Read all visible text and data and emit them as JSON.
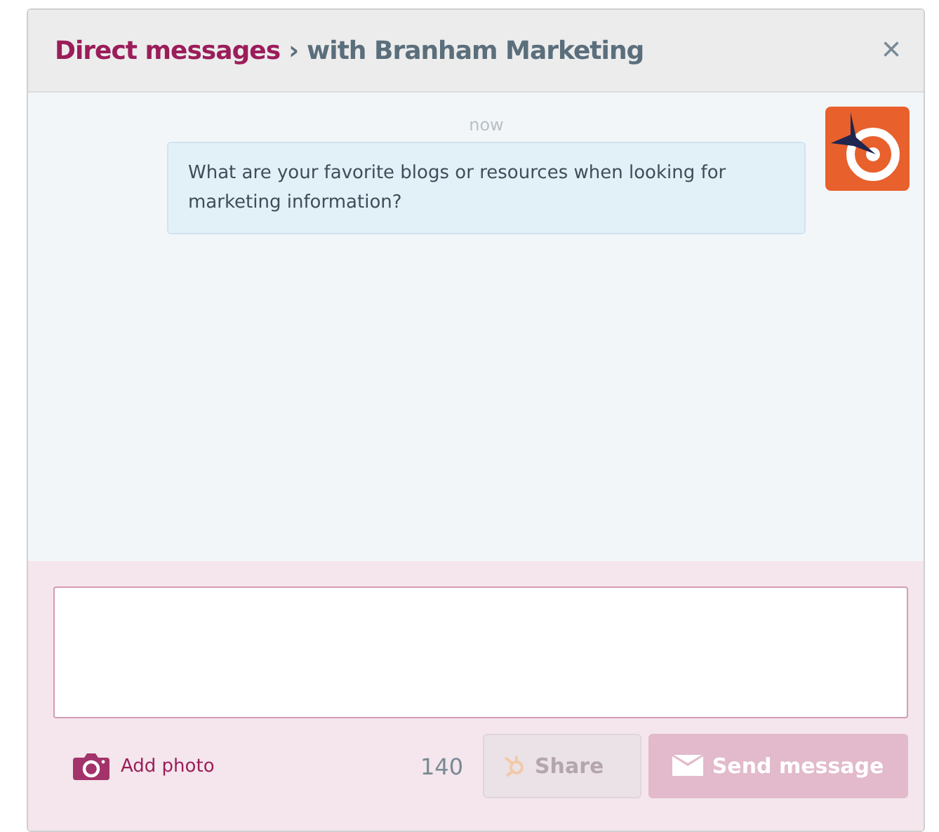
{
  "header": {
    "breadcrumb": "Direct messages",
    "separator": "›",
    "title": "with Branham Marketing",
    "close": "×"
  },
  "messages": [
    {
      "time": "now",
      "text": "What are your favorite blogs or resources when looking for marketing information?"
    }
  ],
  "composer": {
    "add_photo": "Add photo",
    "count": "140",
    "buttons": [
      {
        "kind": "share",
        "label": "Share",
        "disabled": true
      },
      {
        "kind": "send",
        "label": "Send message",
        "disabled": true
      }
    ]
  }
}
